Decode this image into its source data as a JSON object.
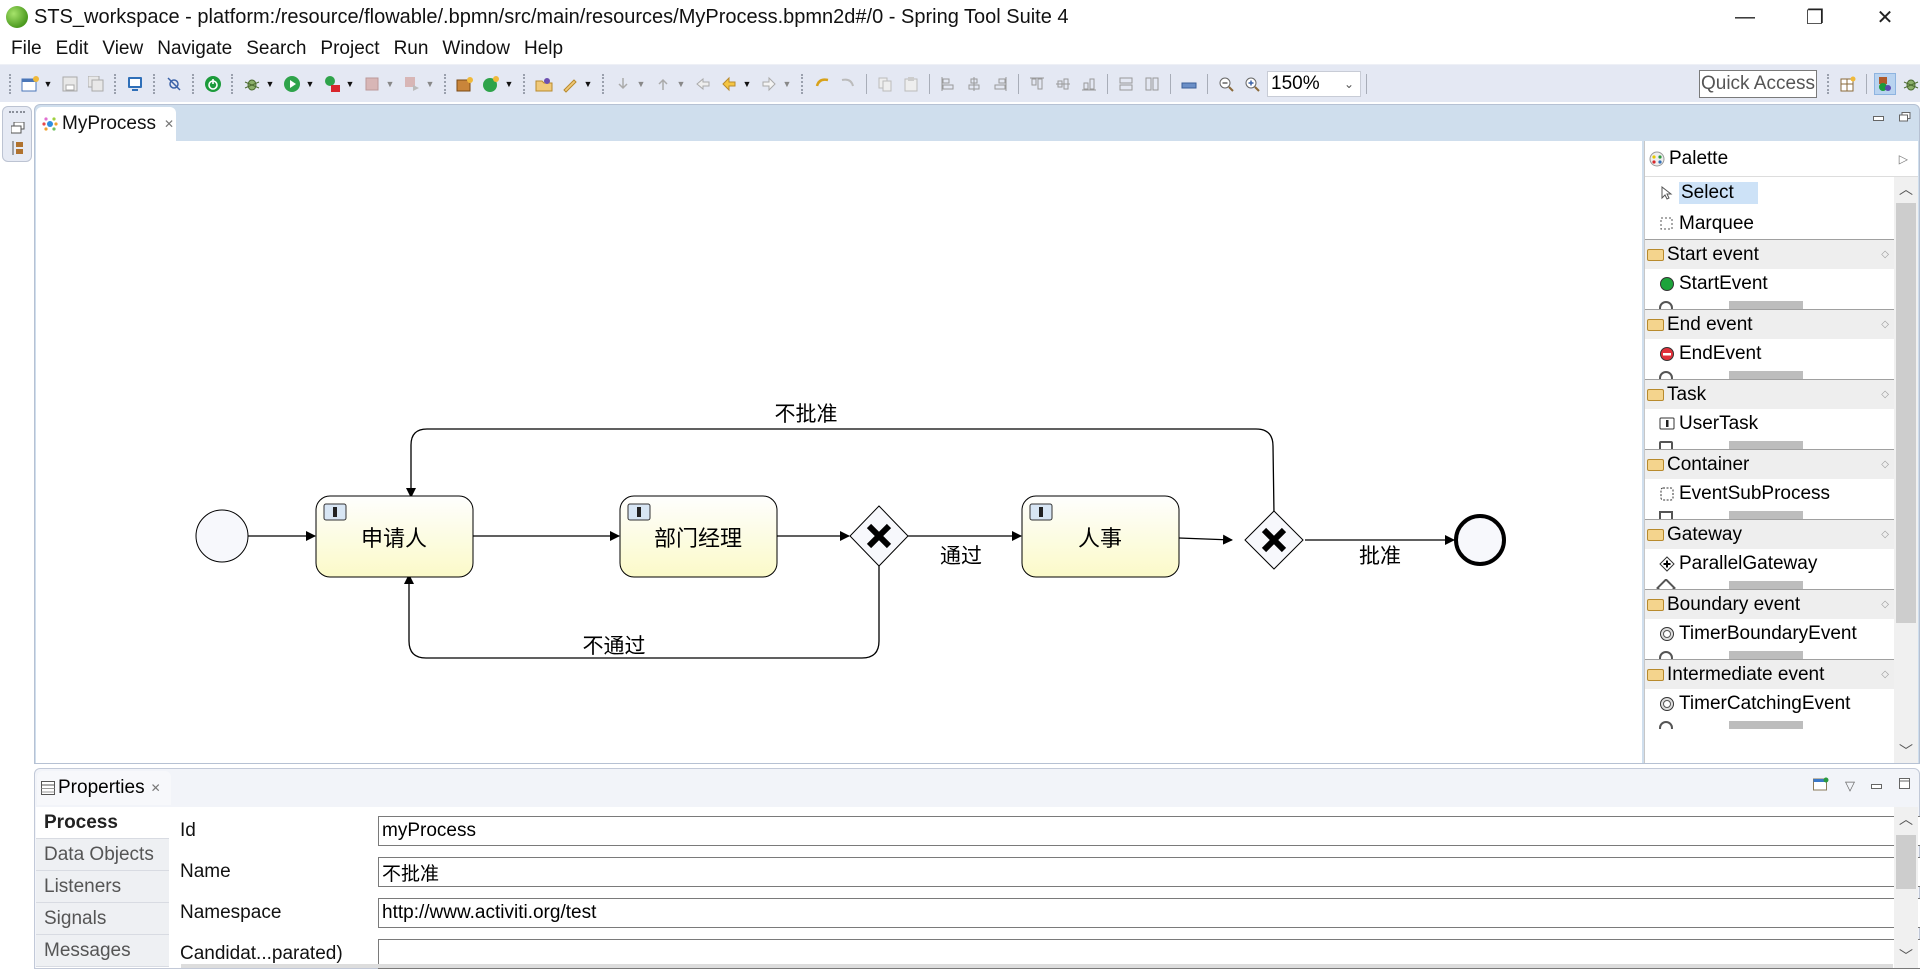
{
  "window": {
    "title": "STS_workspace - platform:/resource/flowable/.bpmn/src/main/resources/MyProcess.bpmn2d#/0 - Spring Tool Suite 4",
    "controls": {
      "minimize": "—",
      "restore": "❐",
      "close": "✕"
    }
  },
  "menu": [
    "File",
    "Edit",
    "View",
    "Navigate",
    "Search",
    "Project",
    "Run",
    "Window",
    "Help"
  ],
  "toolbar": {
    "zoom_level": "150%",
    "quick_access": "Quick Access"
  },
  "editor": {
    "tab_label": "MyProcess",
    "diagram": {
      "start_event": "start",
      "tasks": [
        {
          "id": "applicant",
          "label": "申请人"
        },
        {
          "id": "dept_manager",
          "label": "部门经理"
        },
        {
          "id": "hr",
          "label": "人事"
        }
      ],
      "gateways": [
        {
          "id": "gw1",
          "type": "exclusive"
        },
        {
          "id": "gw2",
          "type": "exclusive"
        }
      ],
      "end_event": "end",
      "flow_labels": {
        "reject_hr": "不批准",
        "reject_manager": "不通过",
        "pass": "通过",
        "approve": "批准"
      }
    }
  },
  "palette": {
    "title": "Palette",
    "tools": [
      {
        "label": "Select",
        "icon": "arrow-cursor-icon",
        "selected": true
      },
      {
        "label": "Marquee",
        "icon": "marquee-icon",
        "selected": false
      }
    ],
    "drawers": [
      {
        "label": "Start event",
        "item": "StartEvent",
        "icon": "start-event-icon"
      },
      {
        "label": "End event",
        "item": "EndEvent",
        "icon": "end-event-icon"
      },
      {
        "label": "Task",
        "item": "UserTask",
        "icon": "user-task-icon"
      },
      {
        "label": "Container",
        "item": "EventSubProcess",
        "icon": "subprocess-icon"
      },
      {
        "label": "Gateway",
        "item": "ParallelGateway",
        "icon": "parallel-gateway-icon"
      },
      {
        "label": "Boundary event",
        "item": "TimerBoundaryEvent",
        "icon": "timer-icon"
      },
      {
        "label": "Intermediate event",
        "item": "TimerCatchingEvent",
        "icon": "timer-icon"
      }
    ]
  },
  "properties": {
    "tab_label": "Properties",
    "nav": [
      "Process",
      "Data Objects",
      "Listeners",
      "Signals",
      "Messages"
    ],
    "active_nav": "Process",
    "fields": [
      {
        "label": "Id",
        "value": "myProcess"
      },
      {
        "label": "Name",
        "value": "不批准"
      },
      {
        "label": "Namespace",
        "value": "http://www.activiti.org/test"
      },
      {
        "label": "Candidat...parated)",
        "value": ""
      }
    ]
  }
}
